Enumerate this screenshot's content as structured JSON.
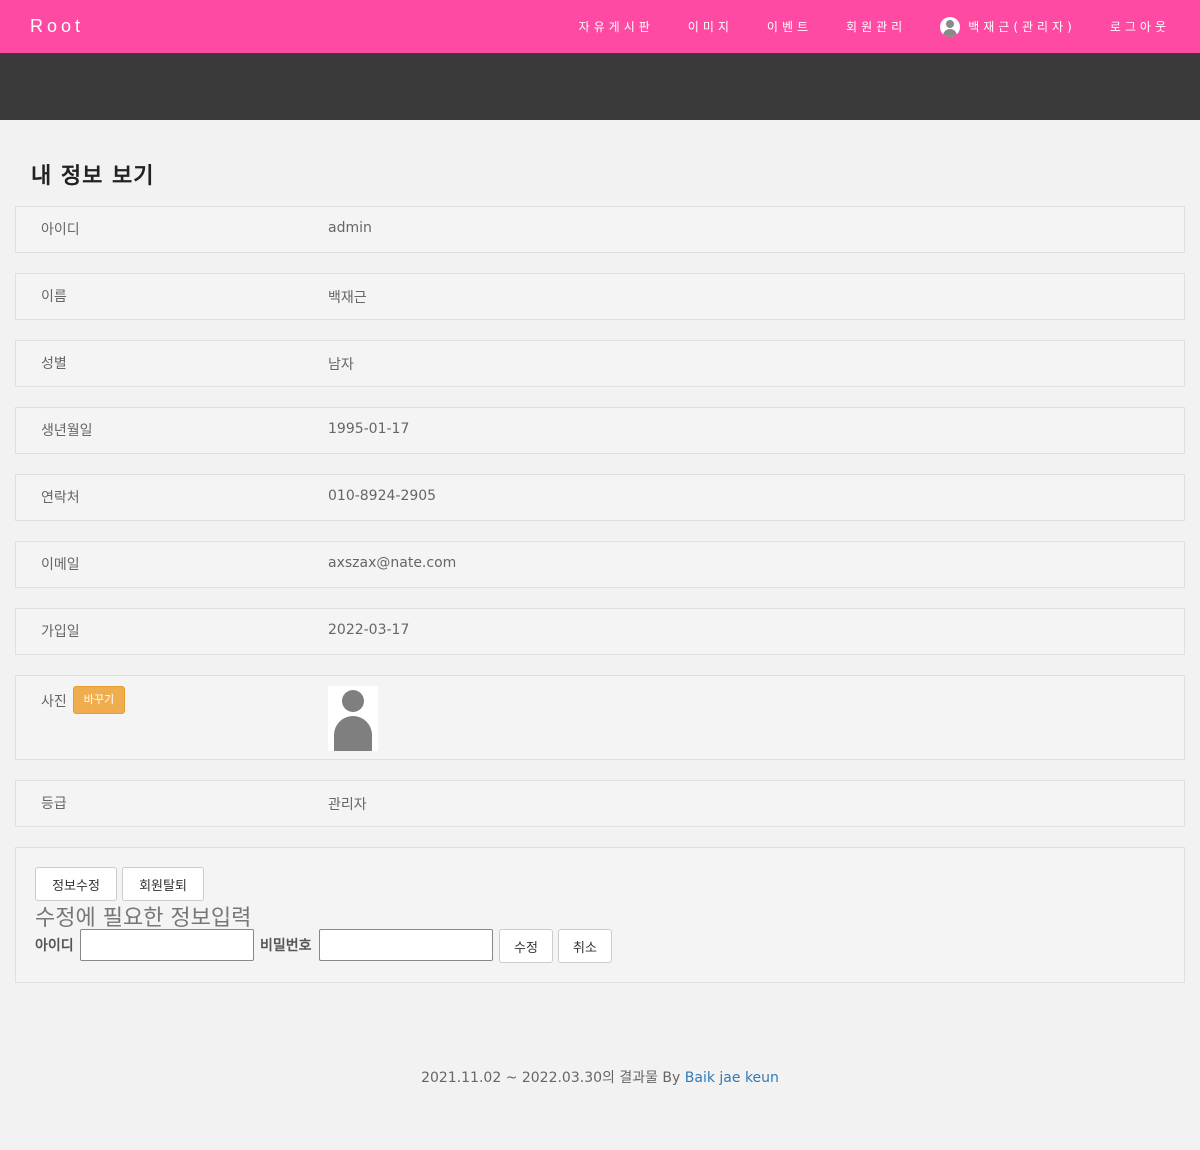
{
  "navbar": {
    "brand": "Root",
    "items": [
      {
        "label": "자유게시판"
      },
      {
        "label": "이미지"
      },
      {
        "label": "이벤트"
      },
      {
        "label": "회원관리"
      }
    ],
    "user_label": "백재근(관리자)",
    "logout_label": "로그아웃",
    "colors": {
      "navbar": "#ff4aa3",
      "band": "#3a3a3a"
    }
  },
  "page": {
    "title": "내 정보 보기"
  },
  "info": {
    "id": {
      "label": "아이디",
      "value": "admin"
    },
    "name": {
      "label": "이름",
      "value": "백재근"
    },
    "gender": {
      "label": "성별",
      "value": "남자"
    },
    "birth": {
      "label": "생년월일",
      "value": "1995-01-17"
    },
    "phone": {
      "label": "연락처",
      "value": "010-8924-2905"
    },
    "email": {
      "label": "이메일",
      "value": "axszax@nate.com"
    },
    "joined": {
      "label": "가입일",
      "value": "2022-03-17"
    },
    "photo": {
      "label": "사진",
      "change_button": "바꾸기",
      "image_icon": "default-profile-icon"
    },
    "grade": {
      "label": "등급",
      "value": "관리자"
    }
  },
  "actions": {
    "edit_info_button": "정보수정",
    "withdraw_button": "회원탈퇴",
    "edit_heading": "수정에 필요한 정보입력",
    "id_label": "아이디",
    "password_label": "비밀번호",
    "id_value": "",
    "password_value": "",
    "submit_button": "수정",
    "cancel_button": "취소",
    "accent_color": "#f0ad4e"
  },
  "footer": {
    "text": "2021.11.02 ~ 2022.03.30의 결과물 By ",
    "link": "Baik jae keun",
    "link_color": "#337ab7"
  }
}
